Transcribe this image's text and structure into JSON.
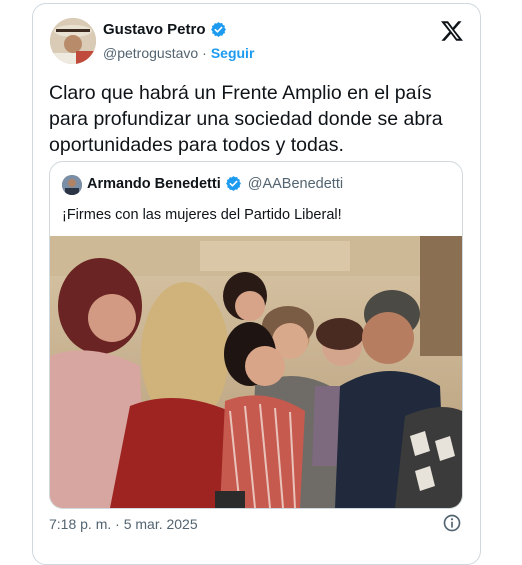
{
  "author": {
    "name": "Gustavo Petro",
    "handle": "@petrogustavo",
    "separator": "·",
    "follow_label": "Seguir"
  },
  "tweet_text": "Claro que habrá un Frente Amplio en el país para profundizar una sociedad donde se abra oportunidades para todos y todas.",
  "quoted": {
    "name": "Armando Benedetti",
    "handle": "@AABenedetti",
    "text": "¡Firmes con las mujeres del Partido Liberal!"
  },
  "timestamp": "7:18 p. m. · 5 mar. 2025",
  "colors": {
    "verified": "#1d9bf0",
    "link": "#1d9bf0",
    "muted": "#536471",
    "border": "#cfd9de"
  },
  "icons": {
    "brand": "x-logo-icon",
    "verified": "verified-badge-icon",
    "info": "info-icon"
  }
}
